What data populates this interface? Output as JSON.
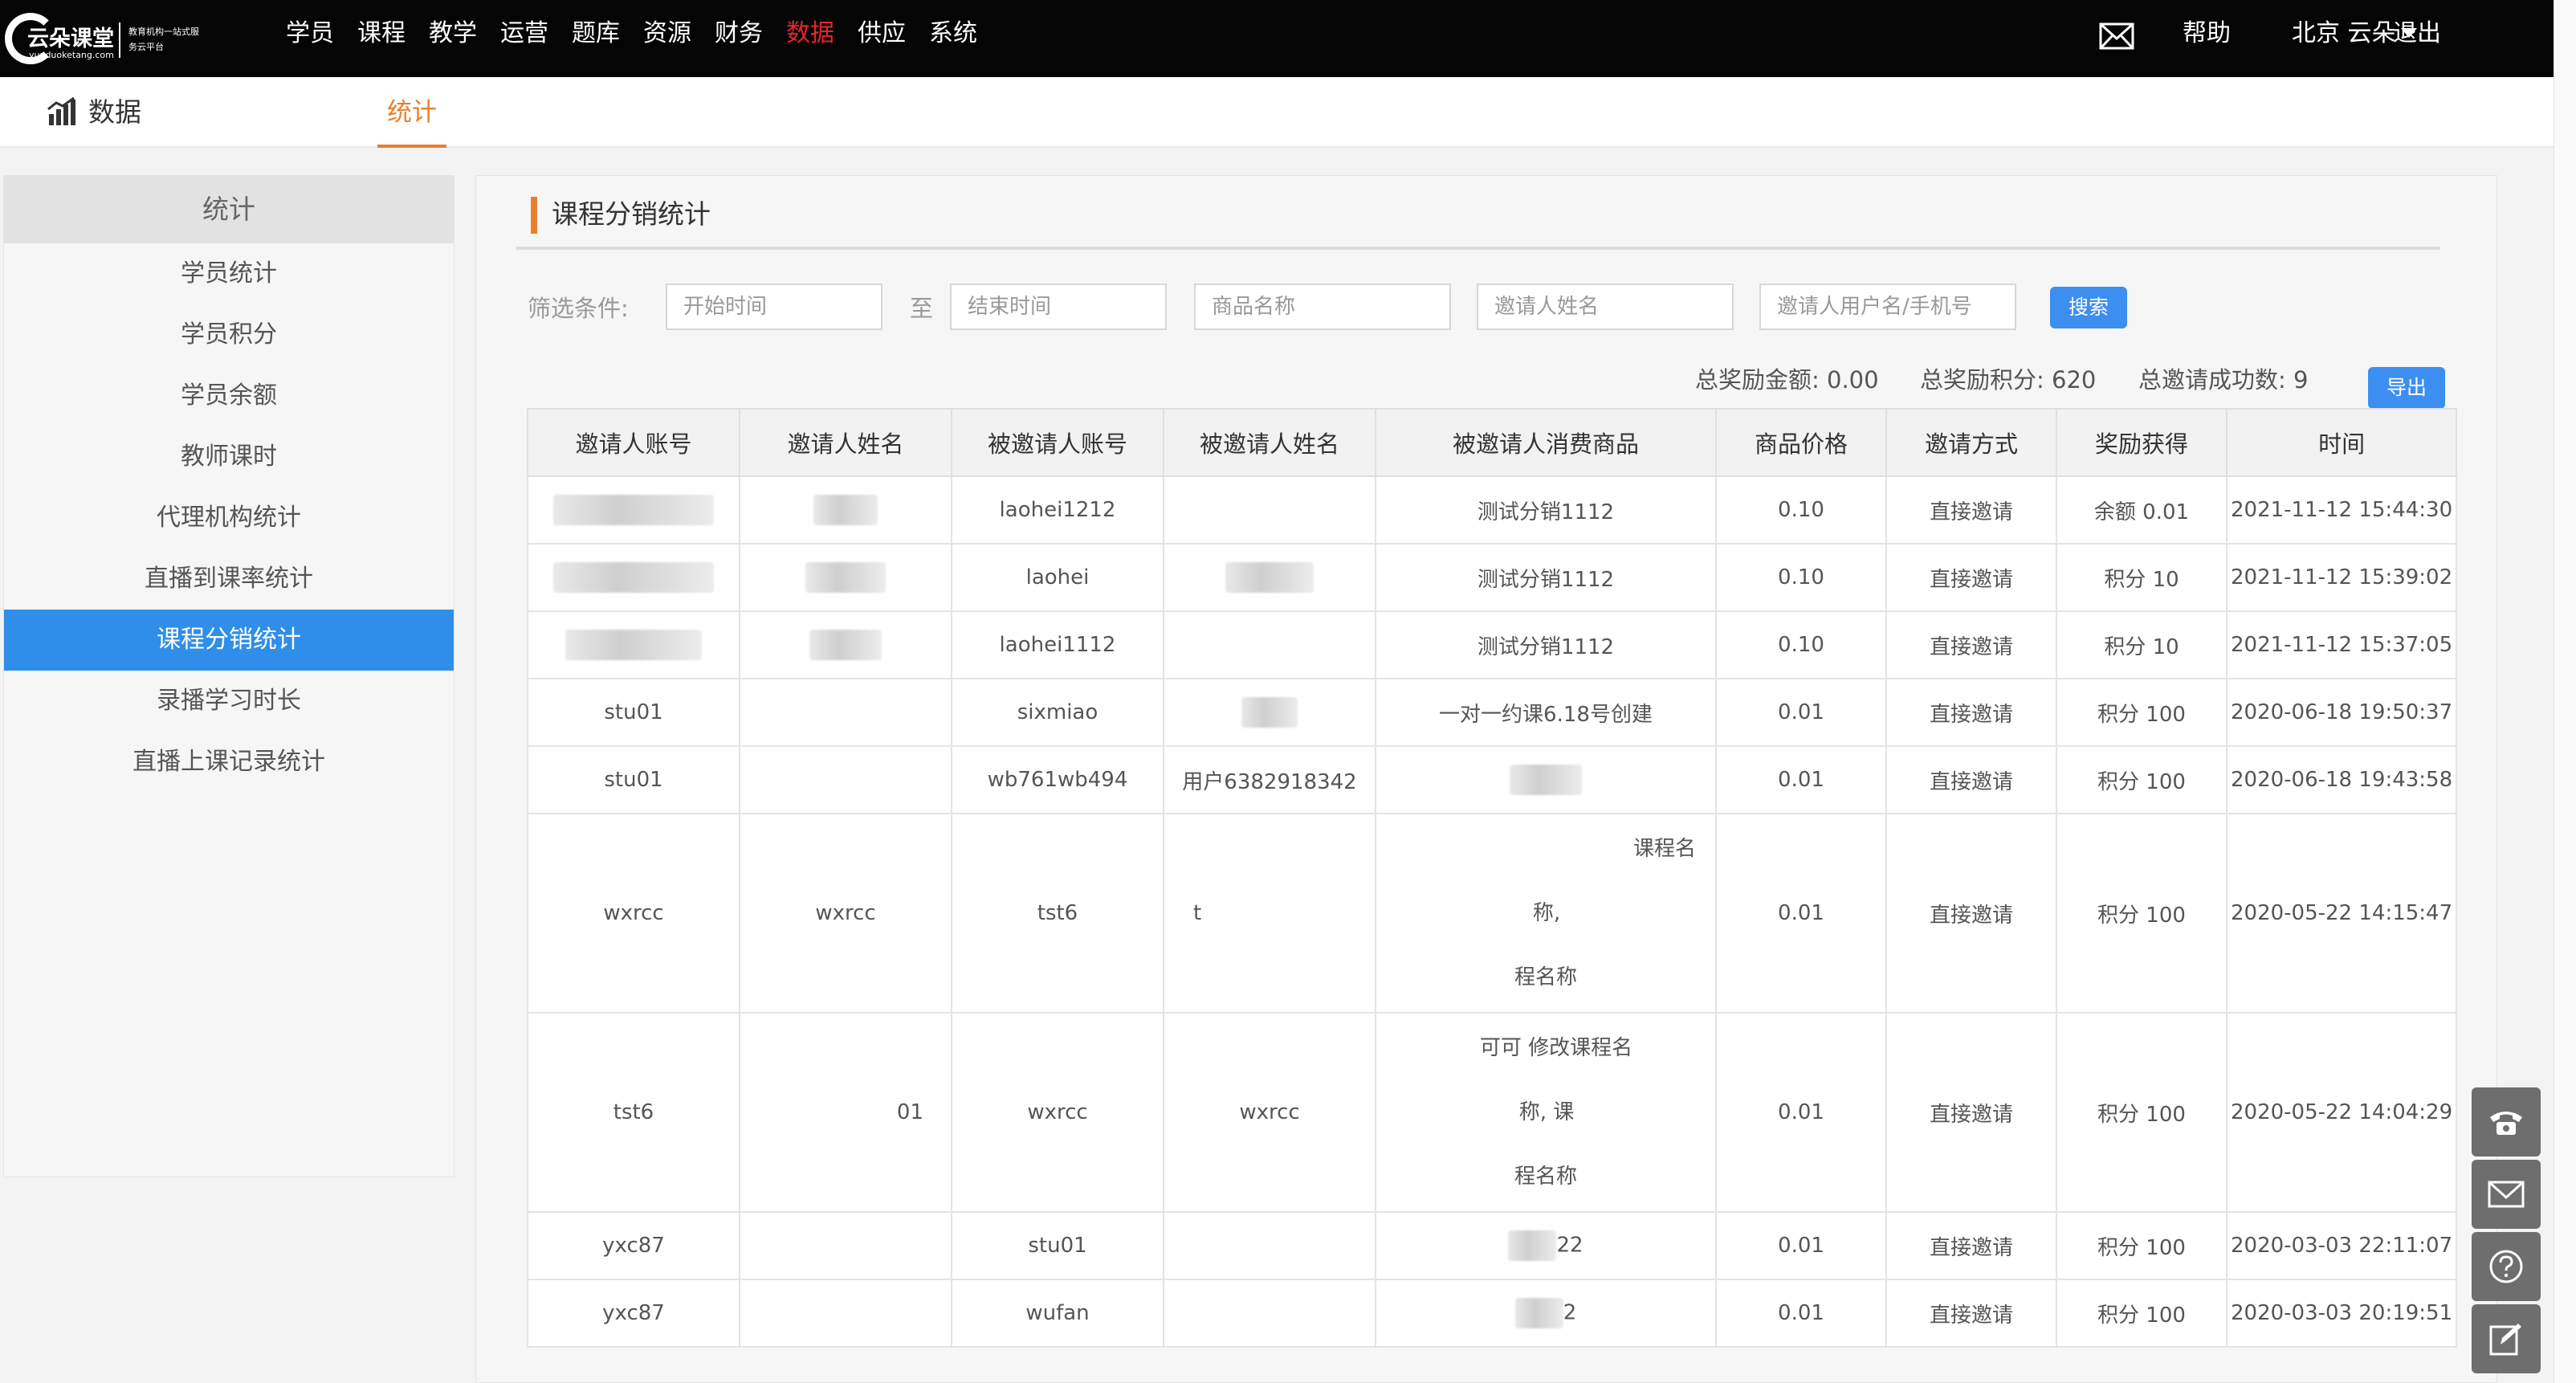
{
  "app": {
    "logo_name": "云朵课堂",
    "logo_url": "yunduoketang.com",
    "logo_slogan": "教育机构一站式服务云平台"
  },
  "nav": {
    "items": [
      "学员",
      "课程",
      "教学",
      "运营",
      "题库",
      "资源",
      "财务",
      "数据",
      "供应",
      "系统"
    ],
    "active": "数据",
    "help": "帮助",
    "user": "北京 云朵",
    "logout": "退出"
  },
  "subheader": {
    "title": "数据",
    "tab": "统计"
  },
  "sidebar": {
    "heading": "统计",
    "items": [
      "学员统计",
      "学员积分",
      "学员余额",
      "教师课时",
      "代理机构统计",
      "直播到课率统计",
      "课程分销统计",
      "录播学习时长",
      "直播上课记录统计"
    ],
    "active_index": 6
  },
  "panel": {
    "title": "课程分销统计",
    "filter_label": "筛选条件:",
    "to_label": "至",
    "start_placeholder": "开始时间",
    "end_placeholder": "结束时间",
    "product_placeholder": "商品名称",
    "inviter_name_placeholder": "邀请人姓名",
    "inviter_user_placeholder": "邀请人用户名/手机号",
    "search_label": "搜索",
    "export_label": "导出",
    "summary": {
      "amount": "总奖励金额: 0.00",
      "points": "总奖励积分: 620",
      "success": "总邀请成功数: 9"
    }
  },
  "table": {
    "headers": [
      "邀请人账号",
      "邀请人姓名",
      "被邀请人账号",
      "被邀请人姓名",
      "被邀请人消费商品",
      "商品价格",
      "邀请方式",
      "奖励获得",
      "时间"
    ],
    "rows": [
      {
        "inviter": "",
        "inviter_name": "",
        "invitee": "laohei1212",
        "invitee_name": "",
        "product": "测试分销1112",
        "price": "0.10",
        "method": "直接邀请",
        "reward": "余额 0.01",
        "time": "2021-11-12 15:44:30"
      },
      {
        "inviter": "",
        "inviter_name": "",
        "invitee": "laohei",
        "invitee_name": "",
        "product": "测试分销1112",
        "price": "0.10",
        "method": "直接邀请",
        "reward": "积分 10",
        "time": "2021-11-12 15:39:02"
      },
      {
        "inviter": "",
        "inviter_name": "",
        "invitee": "laohei1112",
        "invitee_name": "",
        "product": "测试分销1112",
        "price": "0.10",
        "method": "直接邀请",
        "reward": "积分 10",
        "time": "2021-11-12 15:37:05"
      },
      {
        "inviter": "stu01",
        "inviter_name": "",
        "invitee": "sixmiao",
        "invitee_name": "",
        "product": "一对一约课6.18号创建",
        "price": "0.01",
        "method": "直接邀请",
        "reward": "积分 100",
        "time": "2020-06-18 19:50:37"
      },
      {
        "inviter": "stu01",
        "inviter_name": "",
        "invitee": "wb761wb494",
        "invitee_name": "用户6382918342",
        "product": "",
        "price": "0.01",
        "method": "直接邀请",
        "reward": "积分 100",
        "time": "2020-06-18 19:43:58"
      },
      {
        "inviter": "wxrcc",
        "inviter_name": "wxrcc",
        "invitee": "tst6",
        "invitee_name": "t",
        "product_lines": [
          "课程名",
          "称,",
          "程名称"
        ],
        "price": "0.01",
        "method": "直接邀请",
        "reward": "积分 100",
        "time": "2020-05-22 14:15:47"
      },
      {
        "inviter": "tst6",
        "inviter_name": "01",
        "invitee": "wxrcc",
        "invitee_name": "wxrcc",
        "product_lines": [
          "可可 修改课程名",
          "称, 课",
          "程名称"
        ],
        "price": "0.01",
        "method": "直接邀请",
        "reward": "积分 100",
        "time": "2020-05-22 14:04:29"
      },
      {
        "inviter": "yxc87",
        "inviter_name": "",
        "invitee": "stu01",
        "invitee_name": "",
        "product": "22",
        "price": "0.01",
        "method": "直接邀请",
        "reward": "积分 100",
        "time": "2020-03-03 22:11:07"
      },
      {
        "inviter": "yxc87",
        "inviter_name": "",
        "invitee": "wufan",
        "invitee_name": "",
        "product": "2",
        "price": "0.01",
        "method": "直接邀请",
        "reward": "积分 100",
        "time": "2020-03-03 20:19:51"
      }
    ]
  },
  "tools": [
    "phone-icon",
    "mail-icon",
    "help-icon",
    "edit-icon"
  ],
  "colors": {
    "nav_active": "#e8242d",
    "accent_orange": "#e8802f",
    "primary_blue": "#3c8ef0",
    "sidebar_active": "#2f8ee8"
  }
}
